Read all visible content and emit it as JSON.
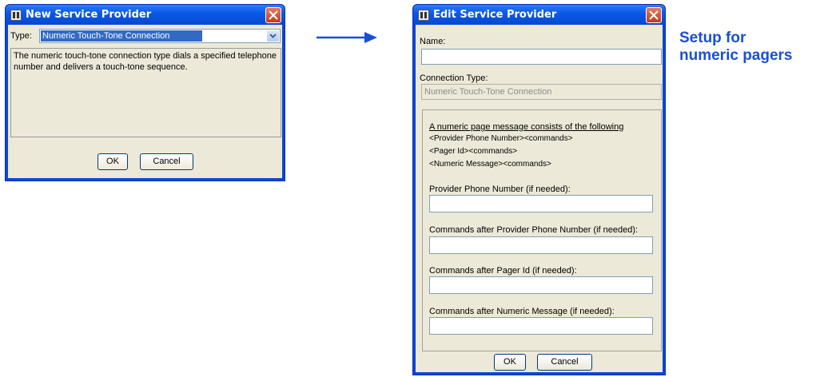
{
  "new_dialog": {
    "title": "New Service Provider",
    "type_label": "Type:",
    "type_value": "Numeric Touch-Tone Connection",
    "description": "The numeric touch-tone connection type dials a specified telephone number and delivers a touch-tone sequence.",
    "ok_label": "OK",
    "cancel_label": "Cancel"
  },
  "edit_dialog": {
    "title": "Edit Service Provider",
    "name_label": "Name:",
    "name_value": "",
    "connection_type_label": "Connection Type:",
    "connection_type_value": "Numeric Touch-Tone Connection",
    "format_heading": "A numeric page message consists of the following",
    "format_lines": [
      "<Provider Phone Number><commands>",
      "<Pager Id><commands>",
      "<Numeric Message><commands>"
    ],
    "fields": [
      {
        "label": "Provider Phone Number (if needed):",
        "value": ""
      },
      {
        "label": "Commands after Provider Phone Number (if needed):",
        "value": ""
      },
      {
        "label": "Commands after Pager Id (if needed):",
        "value": ""
      },
      {
        "label": "Commands after Numeric Message (if needed):",
        "value": ""
      }
    ],
    "ok_label": "OK",
    "cancel_label": "Cancel"
  },
  "caption": {
    "line1": "Setup for",
    "line2": "numeric pagers"
  },
  "colors": {
    "accent": "#1a4fd6",
    "title_bar": "#0a5ae8",
    "dialog_bg": "#ece9d8",
    "selection": "#316ac5"
  }
}
